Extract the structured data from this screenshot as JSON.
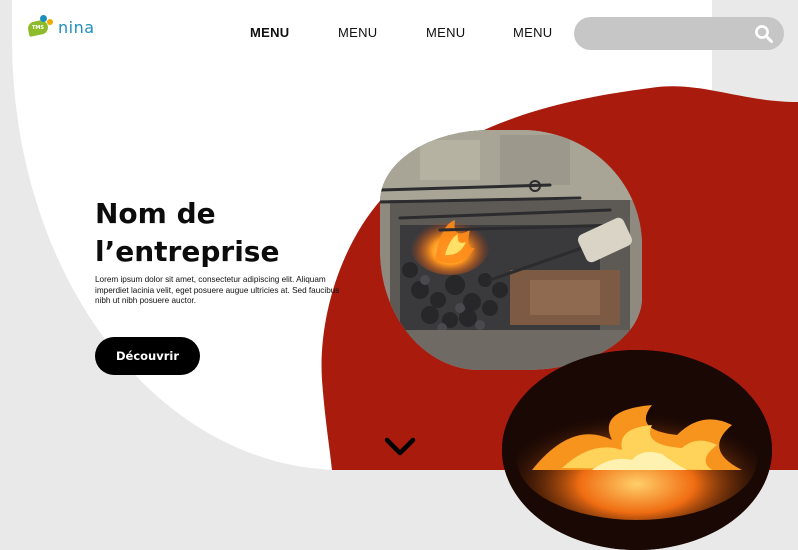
{
  "logo": {
    "tag": "TMS",
    "text": "nina"
  },
  "nav": [
    "MENU",
    "MENU",
    "MENU",
    "MENU"
  ],
  "search": {
    "placeholder": ""
  },
  "hero": {
    "title": "Nom de l’entreprise",
    "description": "Lorem ipsum dolor sit amet, consectetur adipiscing elit. Aliquam imperdiet lacinia velit, eget posuere augue ultricies at. Sed faucibus nibh ut nibh posuere auctor.",
    "button": "Découvrir"
  },
  "colors": {
    "accent": "#a91b0d",
    "logo_blue": "#1d8fbf",
    "logo_green": "#8dbb2a",
    "logo_yellow": "#f2a900",
    "button": "#000000",
    "search_bg": "#c6c6c6"
  },
  "icons": [
    "search-icon",
    "chevron-down-icon"
  ]
}
